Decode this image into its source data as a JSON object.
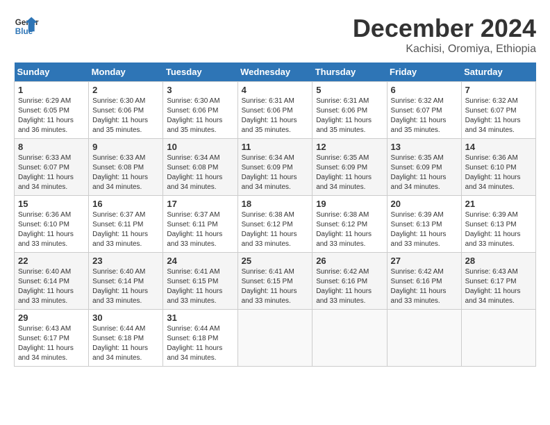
{
  "logo": {
    "text_line1": "General",
    "text_line2": "Blue"
  },
  "title": {
    "month": "December 2024",
    "location": "Kachisi, Oromiya, Ethiopia"
  },
  "headers": [
    "Sunday",
    "Monday",
    "Tuesday",
    "Wednesday",
    "Thursday",
    "Friday",
    "Saturday"
  ],
  "weeks": [
    [
      {
        "day": "1",
        "info": "Sunrise: 6:29 AM\nSunset: 6:05 PM\nDaylight: 11 hours\nand 36 minutes."
      },
      {
        "day": "2",
        "info": "Sunrise: 6:30 AM\nSunset: 6:06 PM\nDaylight: 11 hours\nand 35 minutes."
      },
      {
        "day": "3",
        "info": "Sunrise: 6:30 AM\nSunset: 6:06 PM\nDaylight: 11 hours\nand 35 minutes."
      },
      {
        "day": "4",
        "info": "Sunrise: 6:31 AM\nSunset: 6:06 PM\nDaylight: 11 hours\nand 35 minutes."
      },
      {
        "day": "5",
        "info": "Sunrise: 6:31 AM\nSunset: 6:06 PM\nDaylight: 11 hours\nand 35 minutes."
      },
      {
        "day": "6",
        "info": "Sunrise: 6:32 AM\nSunset: 6:07 PM\nDaylight: 11 hours\nand 35 minutes."
      },
      {
        "day": "7",
        "info": "Sunrise: 6:32 AM\nSunset: 6:07 PM\nDaylight: 11 hours\nand 34 minutes."
      }
    ],
    [
      {
        "day": "8",
        "info": "Sunrise: 6:33 AM\nSunset: 6:07 PM\nDaylight: 11 hours\nand 34 minutes."
      },
      {
        "day": "9",
        "info": "Sunrise: 6:33 AM\nSunset: 6:08 PM\nDaylight: 11 hours\nand 34 minutes."
      },
      {
        "day": "10",
        "info": "Sunrise: 6:34 AM\nSunset: 6:08 PM\nDaylight: 11 hours\nand 34 minutes."
      },
      {
        "day": "11",
        "info": "Sunrise: 6:34 AM\nSunset: 6:09 PM\nDaylight: 11 hours\nand 34 minutes."
      },
      {
        "day": "12",
        "info": "Sunrise: 6:35 AM\nSunset: 6:09 PM\nDaylight: 11 hours\nand 34 minutes."
      },
      {
        "day": "13",
        "info": "Sunrise: 6:35 AM\nSunset: 6:09 PM\nDaylight: 11 hours\nand 34 minutes."
      },
      {
        "day": "14",
        "info": "Sunrise: 6:36 AM\nSunset: 6:10 PM\nDaylight: 11 hours\nand 34 minutes."
      }
    ],
    [
      {
        "day": "15",
        "info": "Sunrise: 6:36 AM\nSunset: 6:10 PM\nDaylight: 11 hours\nand 33 minutes."
      },
      {
        "day": "16",
        "info": "Sunrise: 6:37 AM\nSunset: 6:11 PM\nDaylight: 11 hours\nand 33 minutes."
      },
      {
        "day": "17",
        "info": "Sunrise: 6:37 AM\nSunset: 6:11 PM\nDaylight: 11 hours\nand 33 minutes."
      },
      {
        "day": "18",
        "info": "Sunrise: 6:38 AM\nSunset: 6:12 PM\nDaylight: 11 hours\nand 33 minutes."
      },
      {
        "day": "19",
        "info": "Sunrise: 6:38 AM\nSunset: 6:12 PM\nDaylight: 11 hours\nand 33 minutes."
      },
      {
        "day": "20",
        "info": "Sunrise: 6:39 AM\nSunset: 6:13 PM\nDaylight: 11 hours\nand 33 minutes."
      },
      {
        "day": "21",
        "info": "Sunrise: 6:39 AM\nSunset: 6:13 PM\nDaylight: 11 hours\nand 33 minutes."
      }
    ],
    [
      {
        "day": "22",
        "info": "Sunrise: 6:40 AM\nSunset: 6:14 PM\nDaylight: 11 hours\nand 33 minutes."
      },
      {
        "day": "23",
        "info": "Sunrise: 6:40 AM\nSunset: 6:14 PM\nDaylight: 11 hours\nand 33 minutes."
      },
      {
        "day": "24",
        "info": "Sunrise: 6:41 AM\nSunset: 6:15 PM\nDaylight: 11 hours\nand 33 minutes."
      },
      {
        "day": "25",
        "info": "Sunrise: 6:41 AM\nSunset: 6:15 PM\nDaylight: 11 hours\nand 33 minutes."
      },
      {
        "day": "26",
        "info": "Sunrise: 6:42 AM\nSunset: 6:16 PM\nDaylight: 11 hours\nand 33 minutes."
      },
      {
        "day": "27",
        "info": "Sunrise: 6:42 AM\nSunset: 6:16 PM\nDaylight: 11 hours\nand 33 minutes."
      },
      {
        "day": "28",
        "info": "Sunrise: 6:43 AM\nSunset: 6:17 PM\nDaylight: 11 hours\nand 34 minutes."
      }
    ],
    [
      {
        "day": "29",
        "info": "Sunrise: 6:43 AM\nSunset: 6:17 PM\nDaylight: 11 hours\nand 34 minutes."
      },
      {
        "day": "30",
        "info": "Sunrise: 6:44 AM\nSunset: 6:18 PM\nDaylight: 11 hours\nand 34 minutes."
      },
      {
        "day": "31",
        "info": "Sunrise: 6:44 AM\nSunset: 6:18 PM\nDaylight: 11 hours\nand 34 minutes."
      },
      {
        "day": "",
        "info": ""
      },
      {
        "day": "",
        "info": ""
      },
      {
        "day": "",
        "info": ""
      },
      {
        "day": "",
        "info": ""
      }
    ]
  ]
}
